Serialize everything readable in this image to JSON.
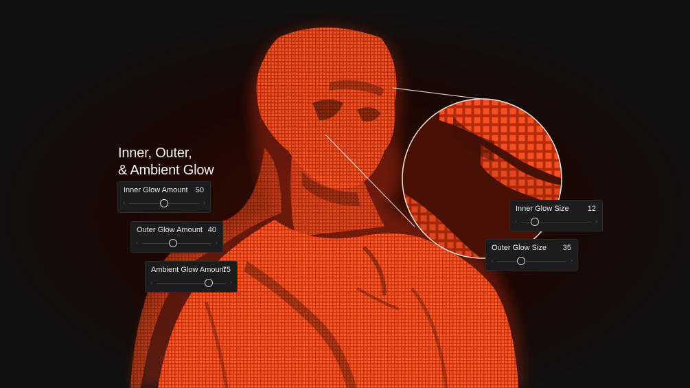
{
  "title": {
    "line1": "Inner, Outer,",
    "line2": "& Ambient Glow"
  },
  "controls": {
    "inner_glow_amount": {
      "label": "Inner Glow Amount",
      "value": "50",
      "position": 0.5
    },
    "outer_glow_amount": {
      "label": "Outer Glow Amount",
      "value": "40",
      "position": 0.45
    },
    "ambient_glow_amount": {
      "label": "Ambient Glow Amount",
      "value": "75",
      "position": 0.75
    },
    "inner_glow_size": {
      "label": "Inner Glow Size",
      "value": "12",
      "position": 0.2
    },
    "outer_glow_size": {
      "label": "Outer Glow Size",
      "value": "35",
      "position": 0.35
    }
  },
  "colors": {
    "background": "#111111",
    "glow": "#ff4a1c",
    "panel": "#1c1c1e"
  },
  "icons": {
    "left": "chevron-left-icon",
    "right": "chevron-right-icon"
  }
}
